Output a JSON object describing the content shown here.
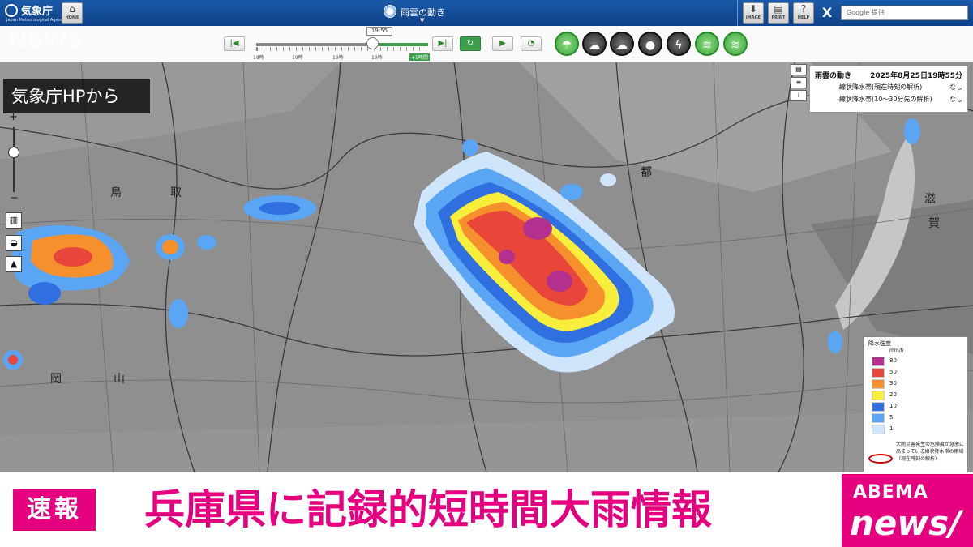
{
  "header": {
    "logo_text": "気象庁",
    "logo_sub": "Japan Meteorological Agency",
    "home_label": "HOME",
    "page_title": "雨雲の動き",
    "image_label": "IMAGE",
    "print_label": "PRINT",
    "help_label": "HELP",
    "x_label": "X",
    "google_placeholder": "Google 提供"
  },
  "timeline": {
    "current_time": "19:55",
    "tick_labels": [
      "18時",
      "19時",
      "19時",
      "19時"
    ],
    "future_label": "+1時間",
    "position_fraction": 0.68
  },
  "map": {
    "places": [
      "鳥",
      "取",
      "都",
      "滋",
      "賀",
      "岡",
      "山"
    ],
    "zoom_in": "+",
    "zoom_out": "−"
  },
  "info_box": {
    "title": "雨雲の動き",
    "datetime": "2025年8月25日19時55分",
    "rows": [
      {
        "label": "線状降水帯(現在時刻の解析)",
        "value": "なし"
      },
      {
        "label": "線状降水帯(10〜30分先の解析)",
        "value": "なし"
      }
    ]
  },
  "legend": {
    "title": "降水強度",
    "unit": "mm/h",
    "levels": [
      {
        "value": "80",
        "color": "#b4308f"
      },
      {
        "value": "50",
        "color": "#e8463a"
      },
      {
        "value": "30",
        "color": "#f5902d"
      },
      {
        "value": "20",
        "color": "#f8ee3c"
      },
      {
        "value": "10",
        "color": "#2f6fe0"
      },
      {
        "value": "5",
        "color": "#5aa6f4"
      },
      {
        "value": "1",
        "color": "#cfe5fb"
      }
    ],
    "note": "大雨災害発生の危険度が急激に高まっている線状降水帯の雨域（現在時刻の解析）"
  },
  "overlay": {
    "source_tag": "気象庁HPから",
    "channel_watermark": "NEWS"
  },
  "ticker": {
    "badge": "速報",
    "headline": "兵庫県に記録的短時間大雨情報"
  },
  "brand": {
    "line1": "ABEMA",
    "line2": "news/"
  }
}
